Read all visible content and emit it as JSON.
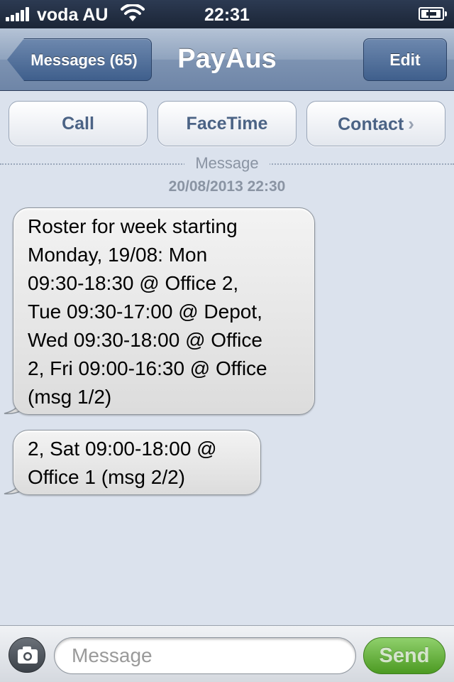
{
  "status_bar": {
    "carrier": "voda AU",
    "time": "22:31",
    "battery_level": 0.95,
    "signal_bars": 5
  },
  "nav": {
    "back_label": "Messages (65)",
    "title": "PayAus",
    "edit_label": "Edit"
  },
  "actions": {
    "call_label": "Call",
    "facetime_label": "FaceTime",
    "contact_label": "Contact",
    "contact_chevron": "›"
  },
  "thread": {
    "divider_label": "Message",
    "timestamp": "20/08/2013 22:30",
    "messages": [
      {
        "direction": "incoming",
        "lines": [
          "Roster for week starting",
          "Monday, 19/08: Mon",
          "09:30-18:30 @ Office 2,",
          "Tue 09:30-17:00 @ Depot,",
          "Wed 09:30-18:00 @ Office",
          "2, Fri 09:00-16:30 @ Office",
          "(msg 1/2)"
        ]
      },
      {
        "direction": "incoming",
        "lines": [
          "2, Sat 09:00-18:00 @",
          "Office 1 (msg 2/2)"
        ]
      }
    ]
  },
  "compose": {
    "placeholder": "Message",
    "value": "",
    "send_label": "Send"
  },
  "colors": {
    "nav_accent": "#3f5f8c",
    "background": "#dbe2ed",
    "send_green": "#4c9a22",
    "action_text": "#4b6385"
  },
  "icons": [
    "signal-icon",
    "wifi-icon",
    "battery-icon",
    "back-arrow-icon",
    "chevron-right-icon",
    "camera-icon"
  ]
}
